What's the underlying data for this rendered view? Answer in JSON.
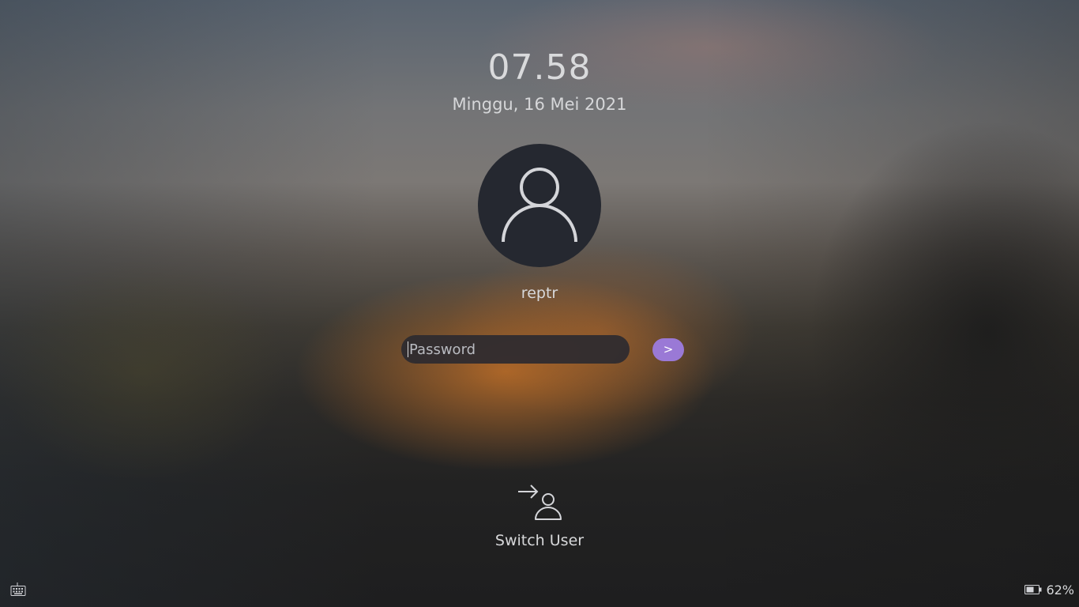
{
  "lock_screen": {
    "clock": "07.58",
    "date": "Minggu, 16 Mei 2021",
    "avatar_icon": "user-avatar-icon",
    "username": "reptr",
    "password_placeholder": "Password",
    "submit_label": ">",
    "switch_user_icon": "switch-user-icon",
    "switch_user_label": "Switch User"
  },
  "status_bar": {
    "keyboard_icon": "keyboard-icon",
    "battery_icon": "battery-icon",
    "battery_percent": "62%"
  },
  "colors": {
    "accent": "#9a79d6",
    "avatar_bg": "#252830",
    "input_bg": "#2c2a30",
    "text": "#d8d9db"
  }
}
